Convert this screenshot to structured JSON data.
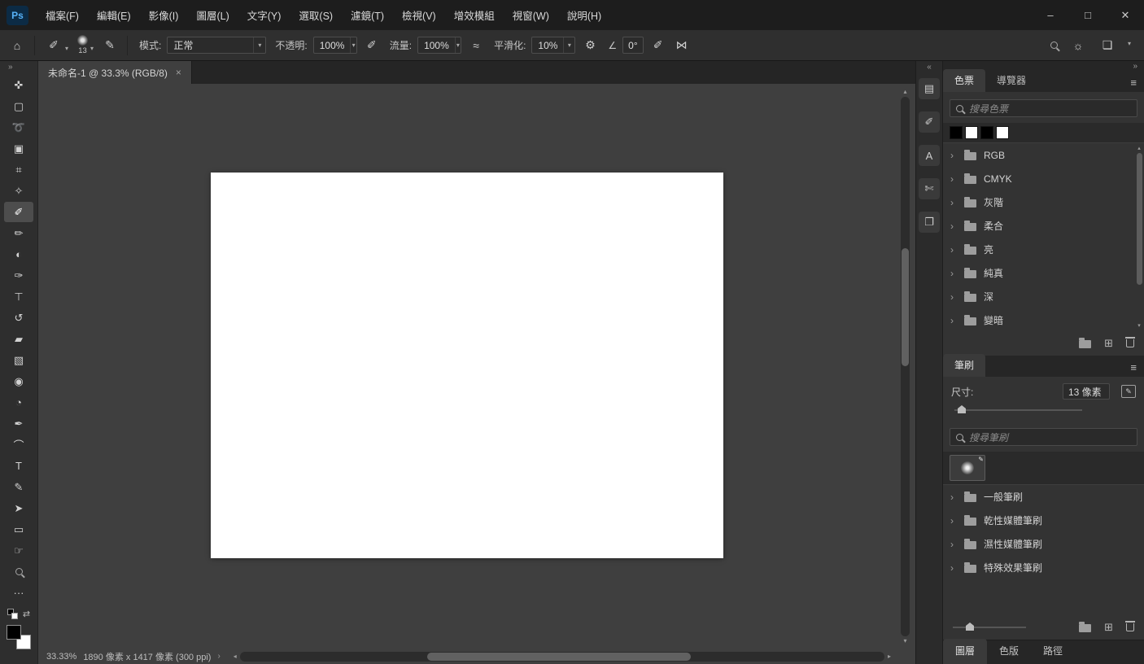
{
  "app": {
    "logo_text": "Ps"
  },
  "menu": {
    "items": [
      "檔案(F)",
      "編輯(E)",
      "影像(I)",
      "圖層(L)",
      "文字(Y)",
      "選取(S)",
      "濾鏡(T)",
      "檢視(V)",
      "增效模組",
      "視窗(W)",
      "說明(H)"
    ]
  },
  "window_controls": {
    "minimize": "–",
    "maximize": "□",
    "close": "✕"
  },
  "options_bar": {
    "brush_size": "13",
    "mode_label": "模式:",
    "mode_value": "正常",
    "opacity_label": "不透明:",
    "opacity_value": "100%",
    "flow_label": "流量:",
    "flow_value": "100%",
    "smoothing_label": "平滑化:",
    "smoothing_value": "10%",
    "angle_value": "0°"
  },
  "document": {
    "tab_title": "未命名-1 @ 33.3% (RGB/8)",
    "close_glyph": "×",
    "zoom_level": "33.33%",
    "size_info": "1890 像素 x 1417 像素 (300 ppi)"
  },
  "toolbar": {
    "tools": [
      {
        "name": "move",
        "glyph": "✜"
      },
      {
        "name": "rectangular-marquee",
        "glyph": "▢"
      },
      {
        "name": "lasso",
        "glyph": "➰"
      },
      {
        "name": "object-selection",
        "glyph": "▣"
      },
      {
        "name": "crop",
        "glyph": "⌗"
      },
      {
        "name": "eyedropper",
        "glyph": "✧"
      },
      {
        "name": "brush",
        "glyph": "✐"
      },
      {
        "name": "pencil",
        "glyph": "✏"
      },
      {
        "name": "color-replacement",
        "glyph": "◐"
      },
      {
        "name": "mixer-brush",
        "glyph": "✑"
      },
      {
        "name": "clone-stamp",
        "glyph": "⊤"
      },
      {
        "name": "history-brush",
        "glyph": "↺"
      },
      {
        "name": "eraser",
        "glyph": "▰"
      },
      {
        "name": "gradient",
        "glyph": "▧"
      },
      {
        "name": "blur",
        "glyph": "◉"
      },
      {
        "name": "dodge",
        "glyph": "◔"
      },
      {
        "name": "pen",
        "glyph": "✒"
      },
      {
        "name": "curvature-pen",
        "glyph": "⌒"
      },
      {
        "name": "type",
        "glyph": "T"
      },
      {
        "name": "freeform-pen",
        "glyph": "✎"
      },
      {
        "name": "path-selection",
        "glyph": "➤"
      },
      {
        "name": "rectangle",
        "glyph": "▭"
      },
      {
        "name": "hand",
        "glyph": "☞"
      },
      {
        "name": "zoom",
        "glyph": ""
      },
      {
        "name": "more",
        "glyph": "···"
      }
    ]
  },
  "colors": {
    "foreground": "#000000",
    "background": "#ffffff"
  },
  "panel_strip": {
    "icons": [
      {
        "name": "properties-panel",
        "glyph": "▤"
      },
      {
        "name": "brush-settings-panel",
        "glyph": "✐"
      },
      {
        "name": "character-panel",
        "glyph": "A"
      },
      {
        "name": "learn-panel",
        "glyph": "✄"
      },
      {
        "name": "libraries-panel",
        "glyph": "❐"
      }
    ]
  },
  "swatches_panel": {
    "tab_swatches": "色票",
    "tab_navigator": "導覽器",
    "search_placeholder": "搜尋色票",
    "recent_swatches": [
      "#000000",
      "#ffffff",
      "#000000",
      "#ffffff"
    ],
    "groups": [
      "RGB",
      "CMYK",
      "灰階",
      "柔合",
      "亮",
      "純真",
      "深",
      "變暗"
    ]
  },
  "brushes_panel": {
    "tab": "筆刷",
    "size_label": "尺寸:",
    "size_value": "13 像素",
    "search_placeholder": "搜尋筆刷",
    "groups": [
      "一般筆刷",
      "乾性媒體筆刷",
      "濕性媒體筆刷",
      "特殊效果筆刷"
    ]
  },
  "bottom_tabs": {
    "layers": "圖層",
    "channels": "色版",
    "paths": "路徑"
  },
  "icons": {
    "home": "⌂",
    "chevron_down": "▾",
    "gear": "⚙",
    "angle": "∠",
    "airbrush": "≈",
    "pressure": "✐",
    "symmetry": "⋈",
    "discover": "☼",
    "workspace": "❏",
    "menu": "≡",
    "collapse_left": "«",
    "collapse_right": "»",
    "chevron_right": "›",
    "chevron_left": "‹",
    "scroll_up": "▴",
    "scroll_down": "▾",
    "scroll_left": "◂",
    "scroll_right": "▸",
    "plus_square": "⊞",
    "swap": "⇄",
    "edit": "✎"
  }
}
